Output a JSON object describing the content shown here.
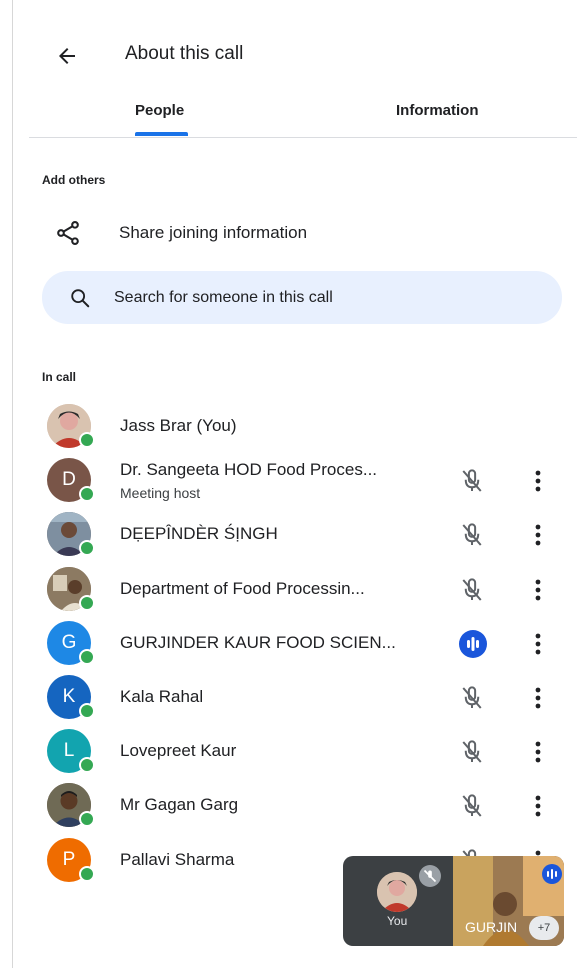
{
  "header": {
    "title": "About this call"
  },
  "tabs": [
    {
      "label": "People",
      "active": true
    },
    {
      "label": "Information",
      "active": false
    }
  ],
  "add_others": {
    "section_label": "Add others",
    "share_label": "Share joining information"
  },
  "search": {
    "placeholder": "Search for someone in this call"
  },
  "in_call": {
    "section_label": "In call",
    "people": [
      {
        "name": "Jass Brar (You)",
        "subtitle": "",
        "avatar": "photo",
        "initial": "",
        "avatar_color": "#c8b3a0",
        "mic": "none"
      },
      {
        "name": "Dr. Sangeeta HOD Food Proces...",
        "subtitle": "Meeting host",
        "avatar": "initial",
        "initial": "D",
        "avatar_color": "#795548",
        "mic": "muted"
      },
      {
        "name": "DẸEPÎNDÈR ŚỊNGH",
        "subtitle": "",
        "avatar": "photo",
        "initial": "",
        "avatar_color": "#6a5a50",
        "mic": "muted"
      },
      {
        "name": "Department of Food Processin...",
        "subtitle": "",
        "avatar": "photo",
        "initial": "",
        "avatar_color": "#7a6a55",
        "mic": "muted"
      },
      {
        "name": "GURJINDER KAUR FOOD SCIEN...",
        "subtitle": "",
        "avatar": "initial",
        "initial": "G",
        "avatar_color": "#1e88e5",
        "mic": "speaking"
      },
      {
        "name": "Kala Rahal",
        "subtitle": "",
        "avatar": "initial",
        "initial": "K",
        "avatar_color": "#1565c0",
        "mic": "muted"
      },
      {
        "name": "Lovepreet Kaur",
        "subtitle": "",
        "avatar": "initial",
        "initial": "L",
        "avatar_color": "#12a4af",
        "mic": "muted"
      },
      {
        "name": "Mr Gagan Garg",
        "subtitle": "",
        "avatar": "photo",
        "initial": "",
        "avatar_color": "#5b4a3a",
        "mic": "muted"
      },
      {
        "name": "Pallavi Sharma",
        "subtitle": "",
        "avatar": "initial",
        "initial": "P",
        "avatar_color": "#ef6c00",
        "mic": "muted"
      }
    ]
  },
  "pip": {
    "self_label": "You",
    "remote_name": "GURJIN",
    "extra_count": "+7"
  },
  "colors": {
    "accent": "#1a73e8",
    "online": "#34a853",
    "search_bg": "#e8f0fe",
    "speaking": "#1a56db"
  }
}
